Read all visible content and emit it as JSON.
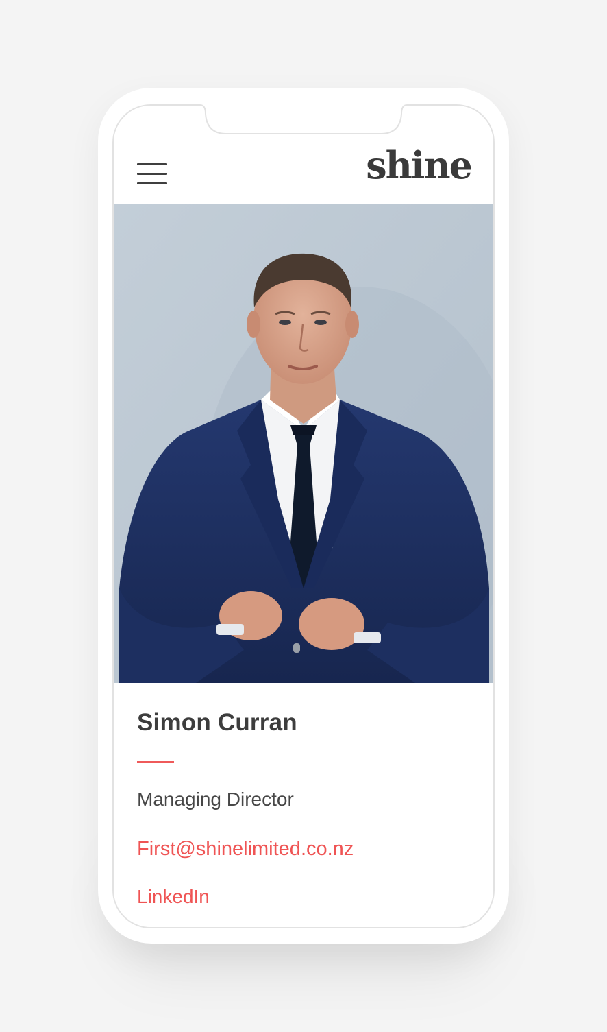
{
  "header": {
    "logo_text": "shine",
    "menu_icon": "hamburger-menu-icon"
  },
  "profile": {
    "photo_alt": "Simon Curran",
    "name": "Simon Curran",
    "role": "Managing Director",
    "email": "First@shinelimited.co.nz",
    "linkedin_label": "LinkedIn"
  },
  "colors": {
    "page_bg": "#f4f4f4",
    "accent": "#ef5454",
    "photo_bg": "#bfcbd6",
    "text_dark": "#3d3d3d"
  }
}
